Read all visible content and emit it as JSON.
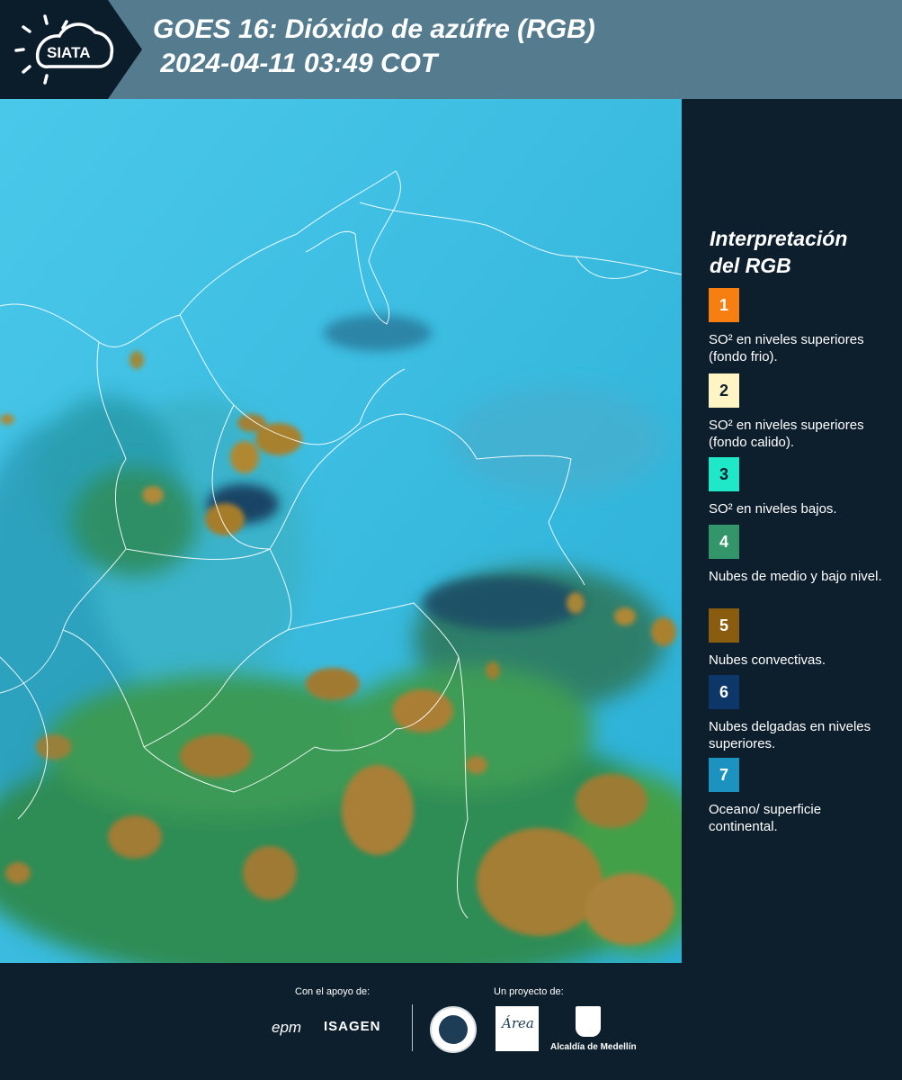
{
  "header": {
    "logo_text": "SIATA",
    "title_line1": "GOES 16: Dióxido de azúfre (RGB)",
    "title_line2": " 2024-04-11 03:49 COT"
  },
  "legend": {
    "title_line1": "Interpretación",
    "title_line2": "del RGB",
    "items": [
      {
        "number": "1",
        "label": "SO² en niveles superiores (fondo frio).",
        "color": "#f77f11"
      },
      {
        "number": "2",
        "label": "SO² en niveles superiores (fondo calido).",
        "color": "#fff5c4"
      },
      {
        "number": "3",
        "label": "SO² en niveles bajos.",
        "color": "#1ee8c8"
      },
      {
        "number": "4",
        "label": "Nubes de medio y bajo nivel.",
        "color": "#33956a"
      },
      {
        "number": "5",
        "label": "Nubes convectivas.",
        "color": "#8a5c10"
      },
      {
        "number": "6",
        "label": "Nubes delgadas en niveles superiores.",
        "color": "#0d3768"
      },
      {
        "number": "7",
        "label": "Oceano/ superficie continental.",
        "color": "#1b92c0"
      }
    ]
  },
  "footer": {
    "support_label": "Con el apoyo de:",
    "project_label": "Un proyecto de:",
    "sponsor_epm": "epm",
    "sponsor_isagen": "ISAGEN",
    "partner_area_logo": "Área",
    "partner_alcaldia": "Alcaldía de Medellín"
  }
}
